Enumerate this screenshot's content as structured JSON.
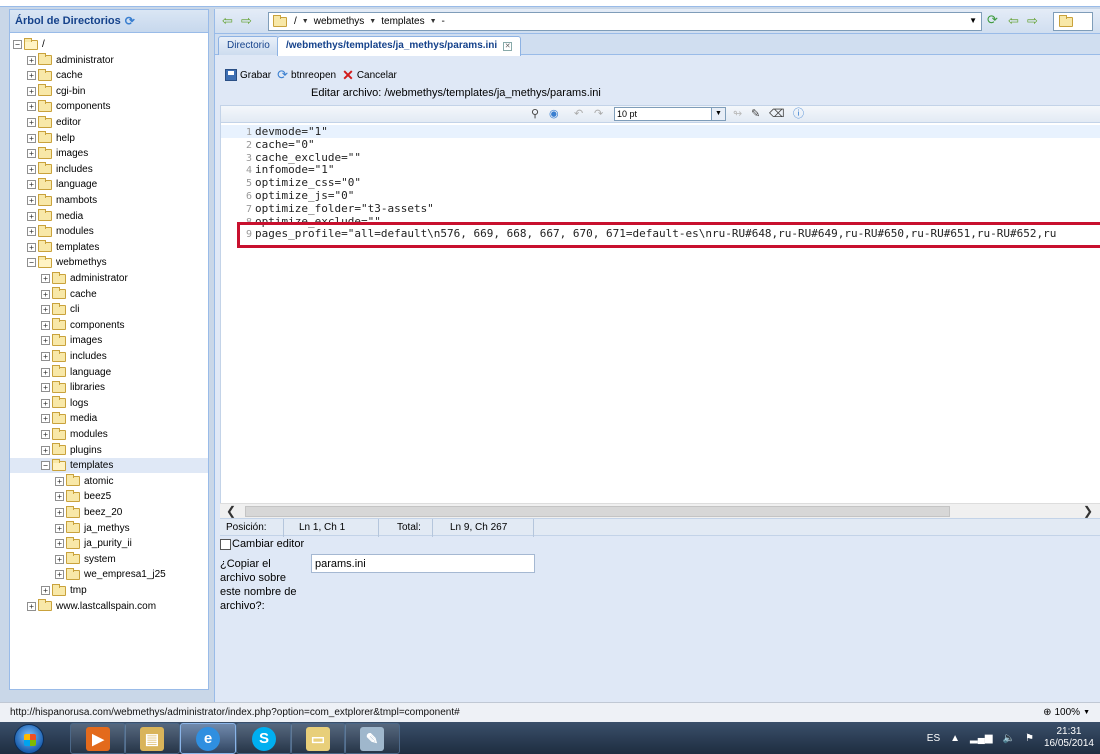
{
  "tree": {
    "title": "Árbol de Directorios",
    "items": [
      {
        "label": "/",
        "level": 0,
        "expanded": true
      },
      {
        "label": "administrator",
        "level": 1,
        "expanded": false
      },
      {
        "label": "cache",
        "level": 1,
        "expanded": false
      },
      {
        "label": "cgi-bin",
        "level": 1,
        "expanded": false
      },
      {
        "label": "components",
        "level": 1,
        "expanded": false
      },
      {
        "label": "editor",
        "level": 1,
        "expanded": false
      },
      {
        "label": "help",
        "level": 1,
        "expanded": false
      },
      {
        "label": "images",
        "level": 1,
        "expanded": false
      },
      {
        "label": "includes",
        "level": 1,
        "expanded": false
      },
      {
        "label": "language",
        "level": 1,
        "expanded": false
      },
      {
        "label": "mambots",
        "level": 1,
        "expanded": false
      },
      {
        "label": "media",
        "level": 1,
        "expanded": false
      },
      {
        "label": "modules",
        "level": 1,
        "expanded": false
      },
      {
        "label": "templates",
        "level": 1,
        "expanded": false
      },
      {
        "label": "webmethys",
        "level": 1,
        "expanded": true
      },
      {
        "label": "administrator",
        "level": 2,
        "expanded": false
      },
      {
        "label": "cache",
        "level": 2,
        "expanded": false
      },
      {
        "label": "cli",
        "level": 2,
        "expanded": false
      },
      {
        "label": "components",
        "level": 2,
        "expanded": false
      },
      {
        "label": "images",
        "level": 2,
        "expanded": false
      },
      {
        "label": "includes",
        "level": 2,
        "expanded": false
      },
      {
        "label": "language",
        "level": 2,
        "expanded": false
      },
      {
        "label": "libraries",
        "level": 2,
        "expanded": false
      },
      {
        "label": "logs",
        "level": 2,
        "expanded": false
      },
      {
        "label": "media",
        "level": 2,
        "expanded": false
      },
      {
        "label": "modules",
        "level": 2,
        "expanded": false
      },
      {
        "label": "plugins",
        "level": 2,
        "expanded": false
      },
      {
        "label": "templates",
        "level": 2,
        "expanded": true,
        "selected": true
      },
      {
        "label": "atomic",
        "level": 3,
        "expanded": false
      },
      {
        "label": "beez5",
        "level": 3,
        "expanded": false
      },
      {
        "label": "beez_20",
        "level": 3,
        "expanded": false
      },
      {
        "label": "ja_methys",
        "level": 3,
        "expanded": false
      },
      {
        "label": "ja_purity_ii",
        "level": 3,
        "expanded": false
      },
      {
        "label": "system",
        "level": 3,
        "expanded": false
      },
      {
        "label": "we_empresa1_j25",
        "level": 3,
        "expanded": false
      },
      {
        "label": "tmp",
        "level": 2,
        "expanded": false
      },
      {
        "label": "www.lastcallspain.com",
        "level": 1,
        "expanded": false
      }
    ]
  },
  "address": {
    "crumbs": [
      "/",
      "webmethys",
      "templates",
      "-"
    ]
  },
  "tabs": [
    {
      "label": "Directorio",
      "active": false
    },
    {
      "label": "/webmethys/templates/ja_methys/params.ini",
      "active": true
    }
  ],
  "toolbar": {
    "save_label": "Grabar",
    "reopen_label": "btnreopen",
    "cancel_label": "Cancelar"
  },
  "editor": {
    "title": "Editar archivo: /webmethys/templates/ja_methys/params.ini",
    "font_size": "10 pt",
    "lines": [
      {
        "n": "1",
        "text": "devmode=\"1\""
      },
      {
        "n": "2",
        "text": "cache=\"0\""
      },
      {
        "n": "3",
        "text": "cache_exclude=\"\""
      },
      {
        "n": "4",
        "text": "infomode=\"1\""
      },
      {
        "n": "5",
        "text": "optimize_css=\"0\""
      },
      {
        "n": "6",
        "text": "optimize_js=\"0\""
      },
      {
        "n": "7",
        "text": "optimize_folder=\"t3-assets\""
      },
      {
        "n": "8",
        "text": "optimize_exclude=\"\""
      },
      {
        "n": "9",
        "text": "pages_profile=\"all=default\\n576, 669, 668, 667, 670, 671=default-es\\nru-RU#648,ru-RU#649,ru-RU#650,ru-RU#651,ru-RU#652,ru"
      }
    ]
  },
  "status": {
    "pos_label": "Posición:",
    "pos_value": "Ln 1, Ch 1",
    "total_label": "Total:",
    "total_value": "Ln 9, Ch 267"
  },
  "form": {
    "cambiar_label": "Cambiar editor",
    "copy_label_lines": [
      "¿Copiar el",
      "archivo sobre",
      "este nombre de",
      "archivo?:"
    ],
    "filename_value": "params.ini"
  },
  "browser": {
    "status_url": "http://hispanorusa.com/webmethys/administrator/index.php?option=com_extplorer&tmpl=component#",
    "zoom": "100%"
  },
  "taskbar": {
    "lang": "ES",
    "time": "21:31",
    "date": "16/05/2014"
  },
  "colors": {
    "highlight": "#c8102e",
    "accent": "#15428b"
  }
}
